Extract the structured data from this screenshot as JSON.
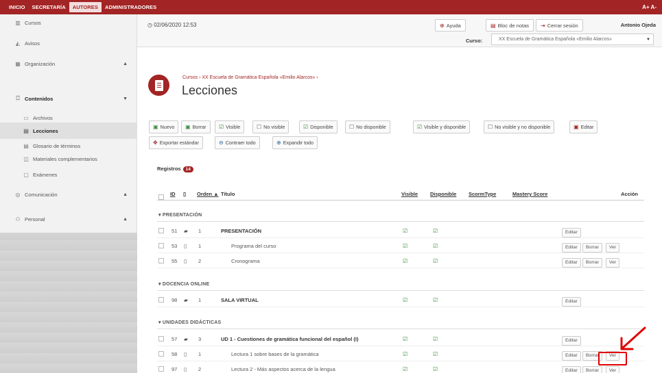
{
  "topnav": {
    "items": [
      {
        "label": "INICIO",
        "active": false
      },
      {
        "label": "SECRETARÍA",
        "active": false
      },
      {
        "label": "AUTORES",
        "active": true
      },
      {
        "label": "ADMINISTRADORES",
        "active": false
      }
    ],
    "font_size_control": "A+ A-"
  },
  "sidebar": {
    "items": [
      {
        "label": "Cursos",
        "icon": "books-icon"
      },
      {
        "label": "Avisos",
        "icon": "megaphone-icon"
      },
      {
        "label": "Organización",
        "icon": "calendar-icon",
        "chevron": "up"
      },
      {
        "label": "Contenidos",
        "icon": "book-icon",
        "chevron": "down",
        "bold": true
      },
      {
        "label": "Archivos",
        "icon": "folder-icon",
        "sub": true
      },
      {
        "label": "Lecciones",
        "icon": "document-icon",
        "sub": true,
        "active": true
      },
      {
        "label": "Glosario de términos",
        "icon": "list-icon",
        "sub": true
      },
      {
        "label": "Materiales complementarios",
        "icon": "attachment-icon",
        "sub": true
      },
      {
        "label": "Exámenes",
        "icon": "exam-icon",
        "sub": true
      },
      {
        "label": "Comunicación",
        "icon": "chat-icon",
        "chevron": "up"
      },
      {
        "label": "Personal",
        "icon": "people-icon",
        "chevron": "up"
      }
    ]
  },
  "header": {
    "datetime": "02/06/2020 12:53",
    "help": "Ayuda",
    "notes": "Bloc de notas",
    "logout": "Cerrar sesión",
    "user": "Antonio Ojeda",
    "course_label": "Curso:",
    "course_value": "XX Escuela de Gramática Española «Emilio Alarcos»"
  },
  "title": {
    "breadcrumb": "Cursos › XX Escuela de Gramática Española «Emilio Alarcos» ›",
    "page_title": "Lecciones"
  },
  "toolbar": {
    "nuevo": "Nuevo",
    "borrar": "Borrar",
    "visible": "Visible",
    "no_visible": "No visible",
    "disponible": "Disponible",
    "no_disponible": "No disponible",
    "visible_y_disponible": "Visible y disponible",
    "no_visible_no_disponible": "No visible y no disponible",
    "editar": "Editar",
    "exportar": "Exportar estándar",
    "contraer": "Contraer todo",
    "expandir": "Expandir todo"
  },
  "table": {
    "registros_label": "Registros",
    "registros_count": "14",
    "headers": {
      "id": "ID",
      "orden": "Orden ▲",
      "titulo": "Título",
      "visible": "Visible",
      "disponible": "Disponible",
      "scormtype": "ScormType",
      "masteryscore": "Mastery Score",
      "accion": "Acción"
    },
    "sections": [
      {
        "label": "▾ PRESENTACIÓN"
      },
      {
        "label": "▾ DOCENCIA ONLINE"
      },
      {
        "label": "▾ UNIDADES DIDÁCTICAS"
      }
    ],
    "rows": [
      {
        "id": "51",
        "orden": "1",
        "titulo": "PRESENTACIÓN"
      },
      {
        "id": "53",
        "orden": "1",
        "titulo": "Programa del curso"
      },
      {
        "id": "55",
        "orden": "2",
        "titulo": "Cronograma"
      },
      {
        "id": "98",
        "orden": "1",
        "titulo": "SALA VIRTUAL"
      },
      {
        "id": "57",
        "orden": "3",
        "titulo": "UD 1 - Cuestiones de gramática funcional del español (I)"
      },
      {
        "id": "58",
        "orden": "1",
        "titulo": "Lectura 1 sobre bases de la gramática"
      },
      {
        "id": "97",
        "orden": "2",
        "titulo": "Lectura 2 - Más aspectos acerca de la lengua"
      }
    ],
    "actions": {
      "editar": "Editar",
      "borrar": "Borrar",
      "ver": "Ver"
    }
  },
  "colors": {
    "brand": "#a32424",
    "highlight": "#e00000",
    "check": "#3c8c3c"
  }
}
